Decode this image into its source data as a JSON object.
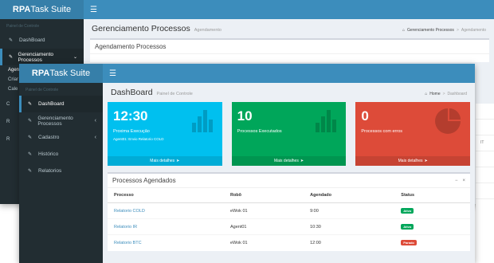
{
  "app": {
    "logo_bold": "RPA",
    "logo_rest": "Task Suite",
    "menu_icon": "bars-icon"
  },
  "back_window": {
    "sidebar_label": "Painel de Controle",
    "sidebar": [
      {
        "label": "DashBoard",
        "icon": "dashboard-icon"
      },
      {
        "label": "Gerenciamento Processos",
        "icon": "gears-icon",
        "chevron": "v"
      }
    ],
    "sub_items": [
      "Agen",
      "Criar",
      "Cale"
    ],
    "peek_letters": [
      "C",
      "R",
      "R"
    ],
    "page_title": "Gerenciamento Processos",
    "page_subtitle": "Agendamento",
    "breadcrumb": {
      "home": "Gerenciamento Processos",
      "current": "Agendamento"
    },
    "box_title": "Agendamento Processos"
  },
  "front_window": {
    "sidebar_label": "Painel de Controle",
    "sidebar": [
      {
        "label": "DashBoard",
        "icon": "dashboard-icon",
        "active": true
      },
      {
        "label": "Gerenciamento Processos",
        "icon": "gears-icon",
        "chevron": "‹"
      },
      {
        "label": "Cadastro",
        "icon": "edit-icon",
        "chevron": "‹"
      },
      {
        "label": "Histórico",
        "icon": "history-icon"
      },
      {
        "label": "Relatorios",
        "icon": "reports-icon"
      }
    ],
    "page_title": "DashBoard",
    "page_subtitle": "Painel de Controle",
    "breadcrumb": {
      "home": "Home",
      "current": "Dashboard"
    },
    "tiles": [
      {
        "value": "12:30",
        "label": "Proxima Execução",
        "detail": "Agent01: Envio Relatorio COLD",
        "more": "Mais detalhes",
        "color": "#00c0ef",
        "icon": "bar-chart-icon"
      },
      {
        "value": "10",
        "label": "Processos Executados",
        "detail": "",
        "more": "Mais detalhes",
        "color": "#00a65a",
        "icon": "bar-chart-icon"
      },
      {
        "value": "0",
        "label": "Processos com erros",
        "detail": "",
        "more": "Mais detalhes",
        "color": "#dd4b39",
        "icon": "pie-chart-icon"
      }
    ],
    "scheduled": {
      "title": "Processos Agendados",
      "tools": [
        "−",
        "×"
      ],
      "columns": [
        "Processo",
        "Robô",
        "Agendado",
        "Status"
      ],
      "rows": [
        {
          "process": "Relatorio COLD",
          "robot": "eWok 01",
          "time": "9:00",
          "status": "Ativo",
          "status_color": "#00a65a"
        },
        {
          "process": "Relatorio IR",
          "robot": "Agent01",
          "time": "10:30",
          "status": "Ativo",
          "status_color": "#00a65a"
        },
        {
          "process": "Relatorio BTC",
          "robot": "eWok 01",
          "time": "12:00",
          "status": "Parado",
          "status_color": "#dd4b39"
        }
      ]
    }
  },
  "right_peek": {
    "text": "IT"
  }
}
